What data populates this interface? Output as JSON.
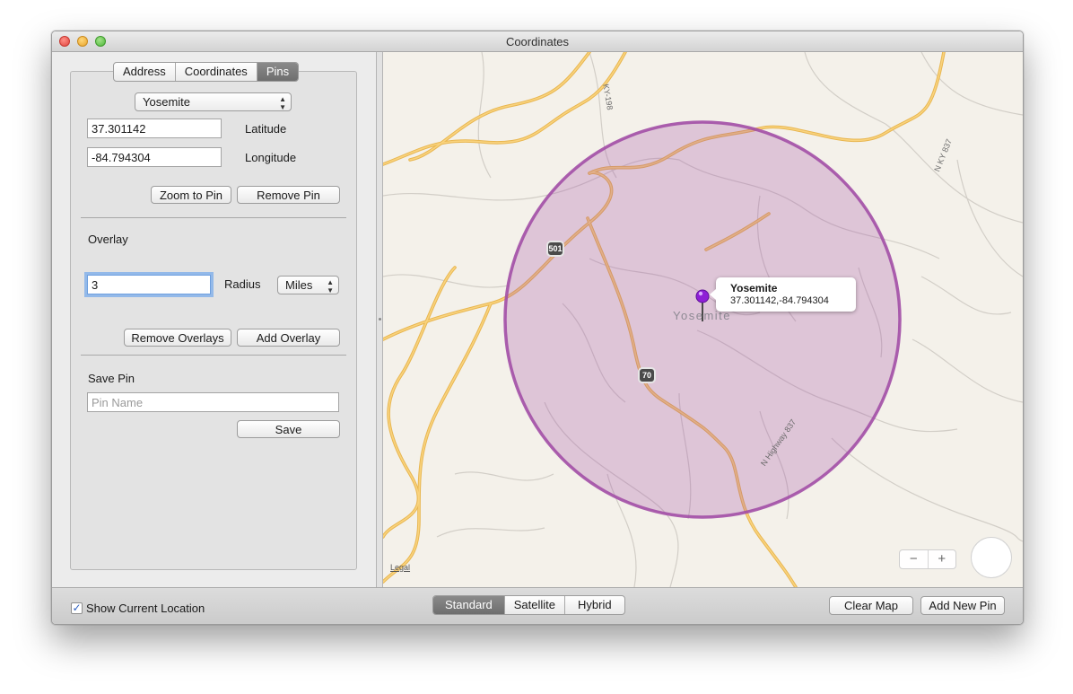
{
  "window": {
    "title": "Coordinates"
  },
  "tabs": [
    {
      "label": "Address",
      "active": false
    },
    {
      "label": "Coordinates",
      "active": false
    },
    {
      "label": "Pins",
      "active": true
    }
  ],
  "pins": {
    "selected_pin": "Yosemite",
    "latitude_value": "37.301142",
    "latitude_label": "Latitude",
    "longitude_value": "-84.794304",
    "longitude_label": "Longitude",
    "zoom_button": "Zoom to Pin",
    "remove_button": "Remove Pin"
  },
  "overlay": {
    "heading": "Overlay",
    "radius_value": "3",
    "radius_label": "Radius",
    "unit": "Miles",
    "remove_overlays_button": "Remove Overlays",
    "add_overlay_button": "Add Overlay"
  },
  "save_pin": {
    "heading": "Save Pin",
    "placeholder": "Pin Name",
    "save_button": "Save"
  },
  "map": {
    "callout_title": "Yosemite",
    "callout_coords": "37.301142,-84.794304",
    "town_label": "Yosemite",
    "shield_501": "501",
    "shield_70": "70",
    "road_ky198": "KY-198",
    "road_nky837": "N KY 837",
    "road_nhighway837": "N Highway 837",
    "legal": "Legal",
    "zoom_out": "−",
    "zoom_in": "+",
    "overlay_color": "#a24ea6",
    "pin_color": "#8e1fd6",
    "road_color": "#f5c25a"
  },
  "bottom_bar": {
    "show_location_label": "Show Current Location",
    "show_location_checked": true,
    "map_types": [
      {
        "label": "Standard",
        "active": true
      },
      {
        "label": "Satellite",
        "active": false
      },
      {
        "label": "Hybrid",
        "active": false
      }
    ],
    "clear_map_button": "Clear Map",
    "add_new_pin_button": "Add New Pin"
  }
}
